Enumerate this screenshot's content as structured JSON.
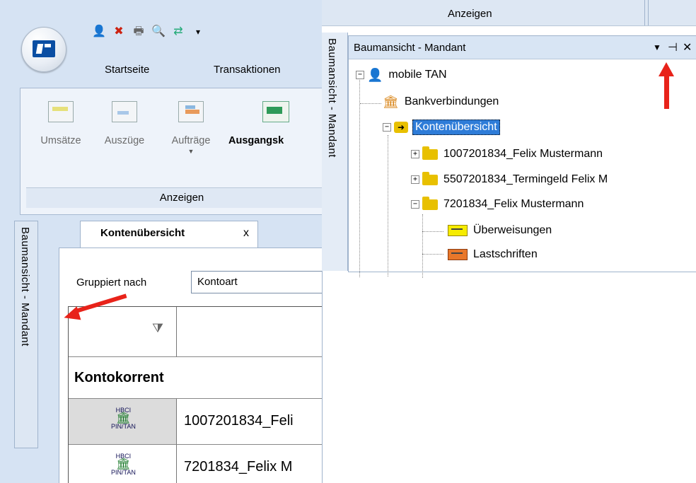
{
  "left_app": {
    "quick_access_icons": [
      "user-icon",
      "cancel-icon",
      "print-icon",
      "print-preview-icon",
      "transfer-icon",
      "dropdown-icon"
    ],
    "ribbon_tabs": [
      "Startseite",
      "Transaktionen"
    ],
    "ribbon_buttons": [
      "Umsätze",
      "Auszüge",
      "Aufträge",
      "Ausgangsk"
    ],
    "ribbon_group_label": "Anzeigen",
    "side_tab_label": "Baumansicht - Mandant",
    "doc_tab": {
      "label": "Kontenübersicht",
      "close": "x"
    },
    "group_by": {
      "label": "Gruppiert nach",
      "value": "Kontoart"
    },
    "grid": {
      "group_header": "Kontokorrent",
      "badge_top": "HBCI",
      "badge_bottom": "PIN/TAN",
      "rows": [
        "1007201834_Feli",
        "7201834_Felix M"
      ]
    }
  },
  "right_panel": {
    "toolbar_label": "Anzeigen",
    "side_tab_label": "Baumansicht - Mandant",
    "title": "Baumansicht - Mandant",
    "controls": [
      "▼",
      "⊣",
      "✕"
    ],
    "tree": {
      "root": "mobile TAN",
      "bank": "Bankverbindungen",
      "overview": "Kontenübersicht",
      "accounts": [
        "1007201834_Felix Mustermann",
        "5507201834_Termingeld Felix M",
        "7201834_Felix Mustermann"
      ],
      "children": [
        "Überweisungen",
        "Lastschriften"
      ]
    }
  },
  "colors": {
    "accent": "#2e7cd8",
    "arrow": "#e8231a",
    "folder": "#e8c000",
    "ribbon_bg": "#d6e3f3"
  }
}
